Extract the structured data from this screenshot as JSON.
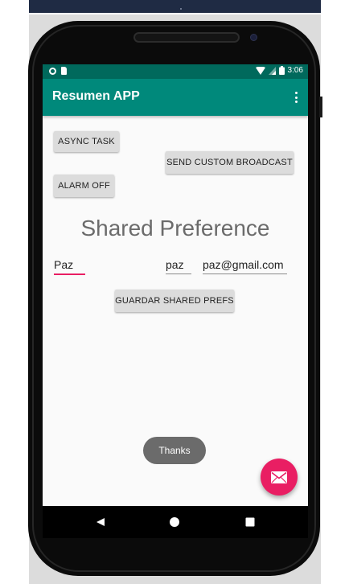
{
  "status_bar": {
    "time": "3:06"
  },
  "app_bar": {
    "title": "Resumen APP",
    "menu_icon": "overflow-menu-icon"
  },
  "buttons": {
    "async_task": "ASYNC TASK",
    "send_broadcast": "SEND CUSTOM BROADCAST",
    "alarm_off": "ALARM OFF",
    "save_prefs": "GUARDAR SHARED PREFS"
  },
  "section_title": "Shared Preference",
  "fields": {
    "name": "Paz",
    "user": "paz",
    "email": "paz@gmail.com"
  },
  "toast": "Thanks",
  "fab_icon": "mail-icon",
  "colors": {
    "primary_dark": "#00695c",
    "primary": "#00897b",
    "accent": "#e91e63"
  }
}
